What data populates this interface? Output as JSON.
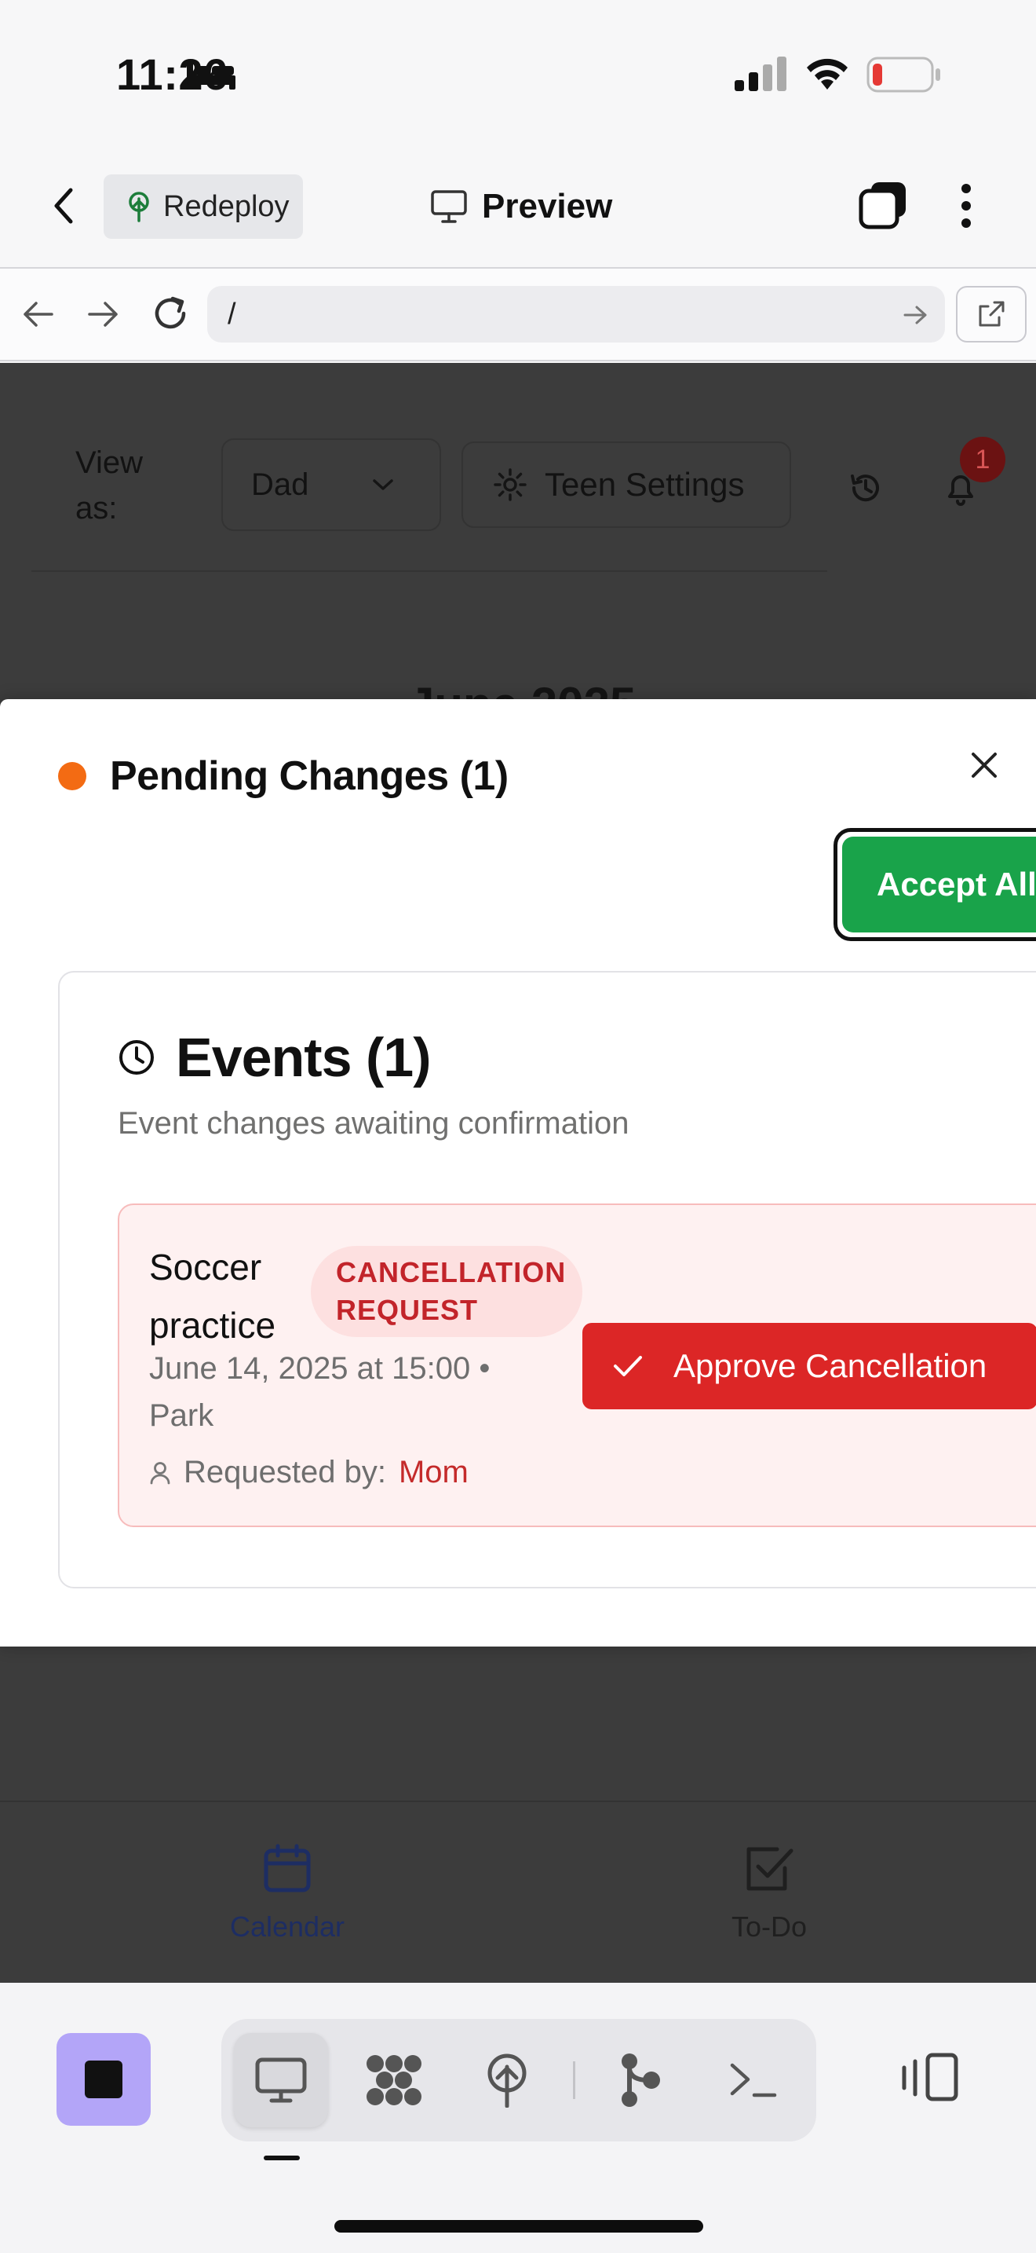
{
  "status_bar": {
    "time": "11:26"
  },
  "app_bar": {
    "redeploy_label": "Redeploy",
    "preview_label": "Preview"
  },
  "browser": {
    "url": "/"
  },
  "background_page": {
    "view_as_label": "View as:",
    "view_as_value": "Dad",
    "teen_settings_label": "Teen Settings",
    "notification_count": "1",
    "month_label": "June 2025",
    "tabs": [
      {
        "label": "Calendar"
      },
      {
        "label": "To-Do"
      }
    ]
  },
  "modal": {
    "title": "Pending Changes (1)",
    "accept_all_label": "Accept All",
    "section": {
      "title": "Events (1)",
      "subtitle": "Event changes awaiting confirmation",
      "items": [
        {
          "name": "Soccer practice",
          "tag": "CANCELLATION REQUEST",
          "meta": "June 14, 2025 at 15:00 • Park",
          "requested_by_label": "Requested by:",
          "requested_by": "Mom",
          "action_label": "Approve Cancellation"
        }
      ]
    }
  },
  "colors": {
    "pending_dot": "#f36b13",
    "accept_green": "#19a34a",
    "approve_red": "#dc2626",
    "stop_purple": "#b3a5f8"
  }
}
